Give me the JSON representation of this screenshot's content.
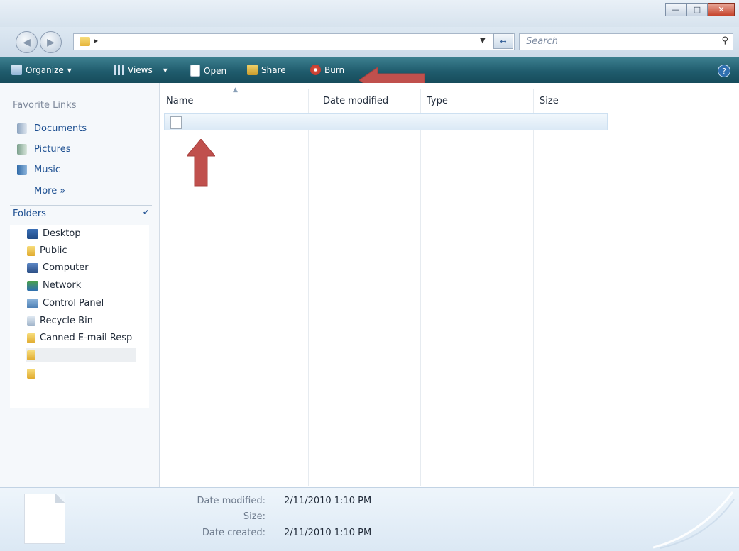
{
  "address_bar": {
    "path_text": ""
  },
  "search": {
    "placeholder": "Search"
  },
  "toolbar": {
    "organize": "Organize",
    "views": "Views",
    "open": "Open",
    "share": "Share",
    "burn": "Burn",
    "help": "?"
  },
  "sidebar": {
    "favorite_links_heading": "Favorite Links",
    "links": [
      "Documents",
      "Pictures",
      "Music"
    ],
    "more": "More",
    "folders_heading": "Folders",
    "tree": [
      "Desktop",
      "Public",
      "Computer",
      "Network",
      "Control Panel",
      "Recycle Bin",
      "Canned E-mail Resp"
    ]
  },
  "columns": [
    "Name",
    "Date modified",
    "Type",
    "Size"
  ],
  "files": [
    {
      "name": "",
      "date_modified": "",
      "type": "",
      "size": ""
    }
  ],
  "details": {
    "date_modified_label": "Date modified:",
    "date_modified_value": "2/11/2010 1:10 PM",
    "size_label": "Size:",
    "size_value": "",
    "date_created_label": "Date created:",
    "date_created_value": "2/11/2010 1:10 PM"
  },
  "colors": {
    "toolbar": "#1f5b6c",
    "annotation_arrow": "#c0504d",
    "link": "#1d4f91"
  },
  "icons": [
    "back-icon",
    "forward-icon",
    "folder-icon",
    "refresh-icon",
    "search-icon",
    "organize-icon",
    "views-icon",
    "open-icon",
    "share-icon",
    "burn-icon",
    "help-icon",
    "documents-icon",
    "pictures-icon",
    "music-icon",
    "desktop-icon",
    "computer-icon",
    "network-icon",
    "control-panel-icon",
    "recycle-bin-icon",
    "file-icon"
  ]
}
